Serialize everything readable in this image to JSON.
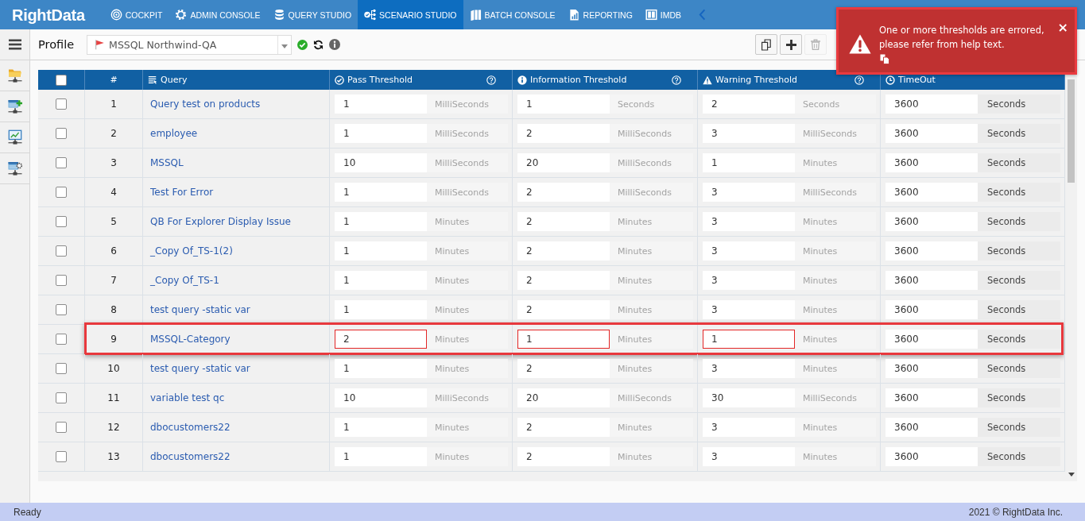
{
  "nav": {
    "logo": "RightData",
    "items": [
      {
        "label": "COCKPIT",
        "selected": false
      },
      {
        "label": "ADMIN CONSOLE",
        "selected": false
      },
      {
        "label": "QUERY STUDIO",
        "selected": false
      },
      {
        "label": "SCENARIO STUDIO",
        "selected": true
      },
      {
        "label": "BATCH CONSOLE",
        "selected": false
      },
      {
        "label": "REPORTING",
        "selected": false
      },
      {
        "label": "IMDB",
        "selected": false
      }
    ]
  },
  "toolbar": {
    "label": "Profile",
    "profile": "MSSQL Northwind-QA",
    "buttons": [
      {
        "kind": "copy",
        "disabled": false
      },
      {
        "kind": "add",
        "disabled": false
      },
      {
        "kind": "delete",
        "disabled": true
      }
    ]
  },
  "table": {
    "all_checked": false,
    "columns": [
      {
        "kind": "select",
        "help": false
      },
      {
        "kind": "number",
        "label": "#",
        "help": false
      },
      {
        "kind": "query",
        "label": "Query",
        "help": false
      },
      {
        "kind": "pass",
        "label": "Pass Threshold",
        "help": true
      },
      {
        "kind": "information",
        "label": "Information Threshold",
        "help": true
      },
      {
        "kind": "warning",
        "label": "Warning Threshold",
        "help": true
      },
      {
        "kind": "timeout",
        "label": "TimeOut",
        "help": false
      }
    ],
    "rows": [
      {
        "checked": false,
        "number": "1",
        "query": "Query test on products",
        "pass": {
          "value": "1",
          "unit": "MilliSeconds"
        },
        "information": {
          "value": "1",
          "unit": "Seconds"
        },
        "warning": {
          "value": "2",
          "unit": "Seconds"
        },
        "timeout": {
          "value": "3600",
          "unit": "Seconds"
        },
        "errored": false,
        "highlighted": false
      },
      {
        "checked": false,
        "number": "2",
        "query": "employee",
        "pass": {
          "value": "1",
          "unit": "MilliSeconds"
        },
        "information": {
          "value": "2",
          "unit": "MilliSeconds"
        },
        "warning": {
          "value": "3",
          "unit": "MilliSeconds"
        },
        "timeout": {
          "value": "3600",
          "unit": "Seconds"
        },
        "errored": false,
        "highlighted": false
      },
      {
        "checked": false,
        "number": "3",
        "query": "MSSQL",
        "pass": {
          "value": "10",
          "unit": "MilliSeconds"
        },
        "information": {
          "value": "20",
          "unit": "MilliSeconds"
        },
        "warning": {
          "value": "1",
          "unit": "Minutes"
        },
        "timeout": {
          "value": "3600",
          "unit": "Seconds"
        },
        "errored": false,
        "highlighted": false
      },
      {
        "checked": false,
        "number": "4",
        "query": "Test For Error",
        "pass": {
          "value": "1",
          "unit": "MilliSeconds"
        },
        "information": {
          "value": "2",
          "unit": "MilliSeconds"
        },
        "warning": {
          "value": "3",
          "unit": "MilliSeconds"
        },
        "timeout": {
          "value": "3600",
          "unit": "Seconds"
        },
        "errored": false,
        "highlighted": false
      },
      {
        "checked": false,
        "number": "5",
        "query": "QB For Explorer Display Issue",
        "pass": {
          "value": "1",
          "unit": "Minutes"
        },
        "information": {
          "value": "2",
          "unit": "Minutes"
        },
        "warning": {
          "value": "3",
          "unit": "Minutes"
        },
        "timeout": {
          "value": "3600",
          "unit": "Seconds"
        },
        "errored": false,
        "highlighted": false
      },
      {
        "checked": false,
        "number": "6",
        "query": "_Copy Of_TS-1(2)",
        "pass": {
          "value": "1",
          "unit": "Minutes"
        },
        "information": {
          "value": "2",
          "unit": "Minutes"
        },
        "warning": {
          "value": "3",
          "unit": "Minutes"
        },
        "timeout": {
          "value": "3600",
          "unit": "Seconds"
        },
        "errored": false,
        "highlighted": false
      },
      {
        "checked": false,
        "number": "7",
        "query": "_Copy Of_TS-1",
        "pass": {
          "value": "1",
          "unit": "Minutes"
        },
        "information": {
          "value": "2",
          "unit": "Minutes"
        },
        "warning": {
          "value": "3",
          "unit": "Minutes"
        },
        "timeout": {
          "value": "3600",
          "unit": "Seconds"
        },
        "errored": false,
        "highlighted": false
      },
      {
        "checked": false,
        "number": "8",
        "query": "test query -static var",
        "pass": {
          "value": "1",
          "unit": "Minutes"
        },
        "information": {
          "value": "2",
          "unit": "Minutes"
        },
        "warning": {
          "value": "3",
          "unit": "Minutes"
        },
        "timeout": {
          "value": "3600",
          "unit": "Seconds"
        },
        "errored": false,
        "highlighted": false
      },
      {
        "checked": false,
        "number": "9",
        "query": "MSSQL-Category",
        "pass": {
          "value": "2",
          "unit": "Minutes"
        },
        "information": {
          "value": "1",
          "unit": "Minutes"
        },
        "warning": {
          "value": "1",
          "unit": "Minutes"
        },
        "timeout": {
          "value": "3600",
          "unit": "Seconds"
        },
        "errored": true,
        "highlighted": true
      },
      {
        "checked": false,
        "number": "10",
        "query": "test query -static var",
        "pass": {
          "value": "1",
          "unit": "Minutes"
        },
        "information": {
          "value": "2",
          "unit": "Minutes"
        },
        "warning": {
          "value": "3",
          "unit": "Minutes"
        },
        "timeout": {
          "value": "3600",
          "unit": "Seconds"
        },
        "errored": false,
        "highlighted": false
      },
      {
        "checked": false,
        "number": "11",
        "query": "variable test qc",
        "pass": {
          "value": "10",
          "unit": "MilliSeconds"
        },
        "information": {
          "value": "20",
          "unit": "MilliSeconds"
        },
        "warning": {
          "value": "30",
          "unit": "MilliSeconds"
        },
        "timeout": {
          "value": "3600",
          "unit": "Seconds"
        },
        "errored": false,
        "highlighted": false
      },
      {
        "checked": false,
        "number": "12",
        "query": "dbocustomers22",
        "pass": {
          "value": "1",
          "unit": "Minutes"
        },
        "information": {
          "value": "2",
          "unit": "Minutes"
        },
        "warning": {
          "value": "3",
          "unit": "Minutes"
        },
        "timeout": {
          "value": "3600",
          "unit": "Seconds"
        },
        "errored": false,
        "highlighted": false
      },
      {
        "checked": false,
        "number": "13",
        "query": "dbocustomers22",
        "pass": {
          "value": "1",
          "unit": "Minutes"
        },
        "information": {
          "value": "2",
          "unit": "Minutes"
        },
        "warning": {
          "value": "3",
          "unit": "Minutes"
        },
        "timeout": {
          "value": "3600",
          "unit": "Seconds"
        },
        "errored": false,
        "highlighted": false
      }
    ]
  },
  "toast": {
    "message": "One or more thresholds are errored, please refer from help text.",
    "close": "×",
    "highlighted": true
  },
  "status_bar": {
    "left": "Ready",
    "right": "2021 © RightData Inc."
  }
}
